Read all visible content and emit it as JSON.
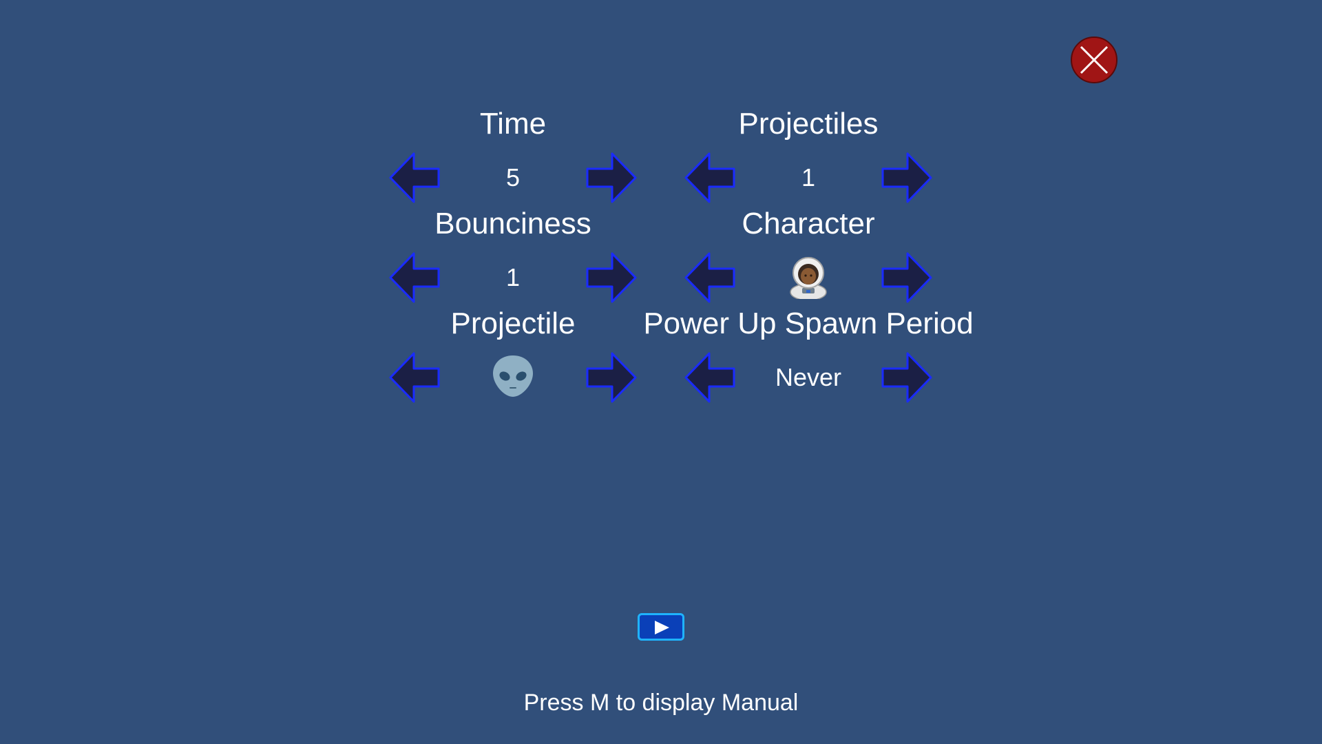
{
  "settings": {
    "time": {
      "label": "Time",
      "value": "5"
    },
    "projectiles": {
      "label": "Projectiles",
      "value": "1"
    },
    "bounciness": {
      "label": "Bounciness",
      "value": "1"
    },
    "character": {
      "label": "Character",
      "value_icon": "astronaut-icon"
    },
    "projectile": {
      "label": "Projectile",
      "value_icon": "alien-icon"
    },
    "power_up_spawn_period": {
      "label": "Power Up Spawn Period",
      "value": "Never"
    }
  },
  "controls": {
    "previous_icon": "left-arrow-icon",
    "next_icon": "right-arrow-icon",
    "close_icon": "close-icon",
    "play_icon": "play-icon"
  },
  "footer": {
    "hint": "Press M to display Manual"
  },
  "colors": {
    "background": "#314f7a",
    "arrow_fill": "#1b1f45",
    "arrow_outline": "#1a2bff",
    "close_fill": "#a01515",
    "play_fill": "#0a40b8",
    "play_border": "#1fb3ff"
  }
}
